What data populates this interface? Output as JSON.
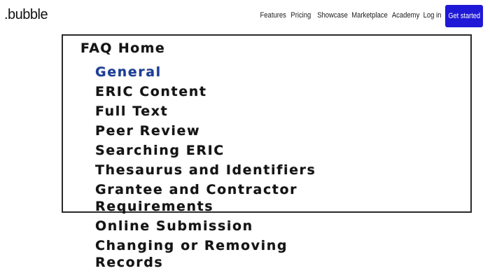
{
  "header": {
    "logo": ".bubble",
    "nav": [
      "Features",
      "Pricing",
      "Showcase",
      "Marketplace",
      "Academy",
      "Log in"
    ],
    "cta": "Get started",
    "cta_color": "#1f18d6"
  },
  "faq": {
    "title": "FAQ Home",
    "items": [
      {
        "lines": [
          "General"
        ]
      },
      {
        "lines": [
          "ERIC Content"
        ]
      },
      {
        "lines": [
          "Full Text"
        ]
      },
      {
        "lines": [
          "Peer Review"
        ]
      },
      {
        "lines": [
          "Searching ERIC"
        ]
      },
      {
        "lines": [
          "Thesaurus and Identifiers"
        ]
      },
      {
        "lines": [
          "Grantee and Contractor",
          "Requirements"
        ]
      },
      {
        "lines": [
          "Online Submission"
        ]
      },
      {
        "lines": [
          "Changing or Removing",
          "Records"
        ]
      }
    ],
    "active_color": "#1c3e9c"
  }
}
